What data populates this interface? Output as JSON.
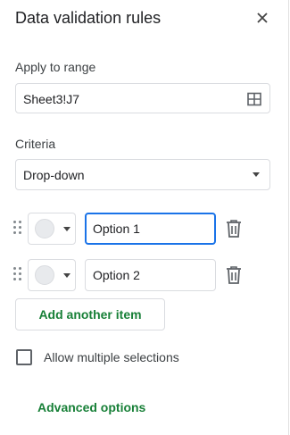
{
  "header": {
    "title": "Data validation rules"
  },
  "range": {
    "label": "Apply to range",
    "value": "Sheet3!J7"
  },
  "criteria": {
    "label": "Criteria",
    "selected": "Drop-down"
  },
  "options": [
    {
      "value": "Option 1",
      "focused": true
    },
    {
      "value": "Option 2",
      "focused": false
    }
  ],
  "add_item_label": "Add another item",
  "allow_multiple": {
    "label": "Allow multiple selections",
    "checked": false
  },
  "advanced_label": "Advanced options",
  "colors": {
    "accent_green": "#188038",
    "focus_blue": "#1a73e8",
    "chip_default": "#e8eaed"
  }
}
